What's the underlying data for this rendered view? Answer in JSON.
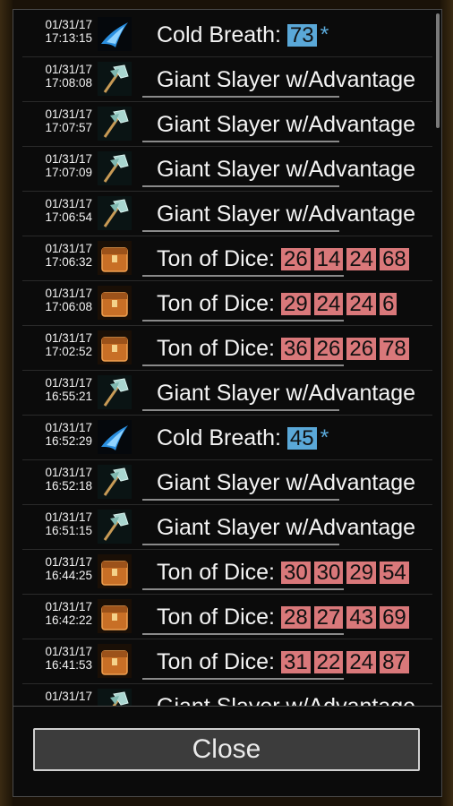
{
  "close_label": "Close",
  "colors": {
    "blue_badge": "#5aa8d8",
    "red_badge": "#d9787a"
  },
  "rows": [
    {
      "date": "01/31/17",
      "time": "17:13:15",
      "icon": "cold-breath-icon",
      "label": "Cold Breath:",
      "badges": [
        "73"
      ],
      "star": "*",
      "kind": "blue"
    },
    {
      "date": "01/31/17",
      "time": "17:08:08",
      "icon": "axe-icon",
      "label": "Giant Slayer w/Advantage",
      "badges": [],
      "star": "",
      "kind": ""
    },
    {
      "date": "01/31/17",
      "time": "17:07:57",
      "icon": "axe-icon",
      "label": "Giant Slayer w/Advantage",
      "badges": [],
      "star": "",
      "kind": ""
    },
    {
      "date": "01/31/17",
      "time": "17:07:09",
      "icon": "axe-icon",
      "label": "Giant Slayer w/Advantage",
      "badges": [],
      "star": "",
      "kind": ""
    },
    {
      "date": "01/31/17",
      "time": "17:06:54",
      "icon": "axe-icon",
      "label": "Giant Slayer w/Advantage",
      "badges": [],
      "star": "",
      "kind": ""
    },
    {
      "date": "01/31/17",
      "time": "17:06:32",
      "icon": "chest-icon",
      "label": "Ton of Dice:",
      "badges": [
        "26",
        "14",
        "24",
        "68"
      ],
      "star": "",
      "kind": "red"
    },
    {
      "date": "01/31/17",
      "time": "17:06:08",
      "icon": "chest-icon",
      "label": "Ton of Dice:",
      "badges": [
        "29",
        "24",
        "24",
        "6"
      ],
      "star": "",
      "kind": "red"
    },
    {
      "date": "01/31/17",
      "time": "17:02:52",
      "icon": "chest-icon",
      "label": "Ton of Dice:",
      "badges": [
        "36",
        "26",
        "26",
        "78"
      ],
      "star": "",
      "kind": "red"
    },
    {
      "date": "01/31/17",
      "time": "16:55:21",
      "icon": "axe-icon",
      "label": "Giant Slayer w/Advantage",
      "badges": [],
      "star": "",
      "kind": ""
    },
    {
      "date": "01/31/17",
      "time": "16:52:29",
      "icon": "cold-breath-icon",
      "label": "Cold Breath:",
      "badges": [
        "45"
      ],
      "star": "*",
      "kind": "blue"
    },
    {
      "date": "01/31/17",
      "time": "16:52:18",
      "icon": "axe-icon",
      "label": "Giant Slayer w/Advantage",
      "badges": [],
      "star": "",
      "kind": ""
    },
    {
      "date": "01/31/17",
      "time": "16:51:15",
      "icon": "axe-icon",
      "label": "Giant Slayer w/Advantage",
      "badges": [],
      "star": "",
      "kind": ""
    },
    {
      "date": "01/31/17",
      "time": "16:44:25",
      "icon": "chest-icon",
      "label": "Ton of Dice:",
      "badges": [
        "30",
        "30",
        "29",
        "54"
      ],
      "star": "",
      "kind": "red"
    },
    {
      "date": "01/31/17",
      "time": "16:42:22",
      "icon": "chest-icon",
      "label": "Ton of Dice:",
      "badges": [
        "28",
        "27",
        "43",
        "69"
      ],
      "star": "",
      "kind": "red"
    },
    {
      "date": "01/31/17",
      "time": "16:41:53",
      "icon": "chest-icon",
      "label": "Ton of Dice:",
      "badges": [
        "31",
        "22",
        "24",
        "87"
      ],
      "star": "",
      "kind": "red"
    },
    {
      "date": "01/31/17",
      "time": "",
      "icon": "axe-icon",
      "label": "Giant Slayer w/Advantage",
      "badges": [],
      "star": "",
      "kind": ""
    }
  ]
}
